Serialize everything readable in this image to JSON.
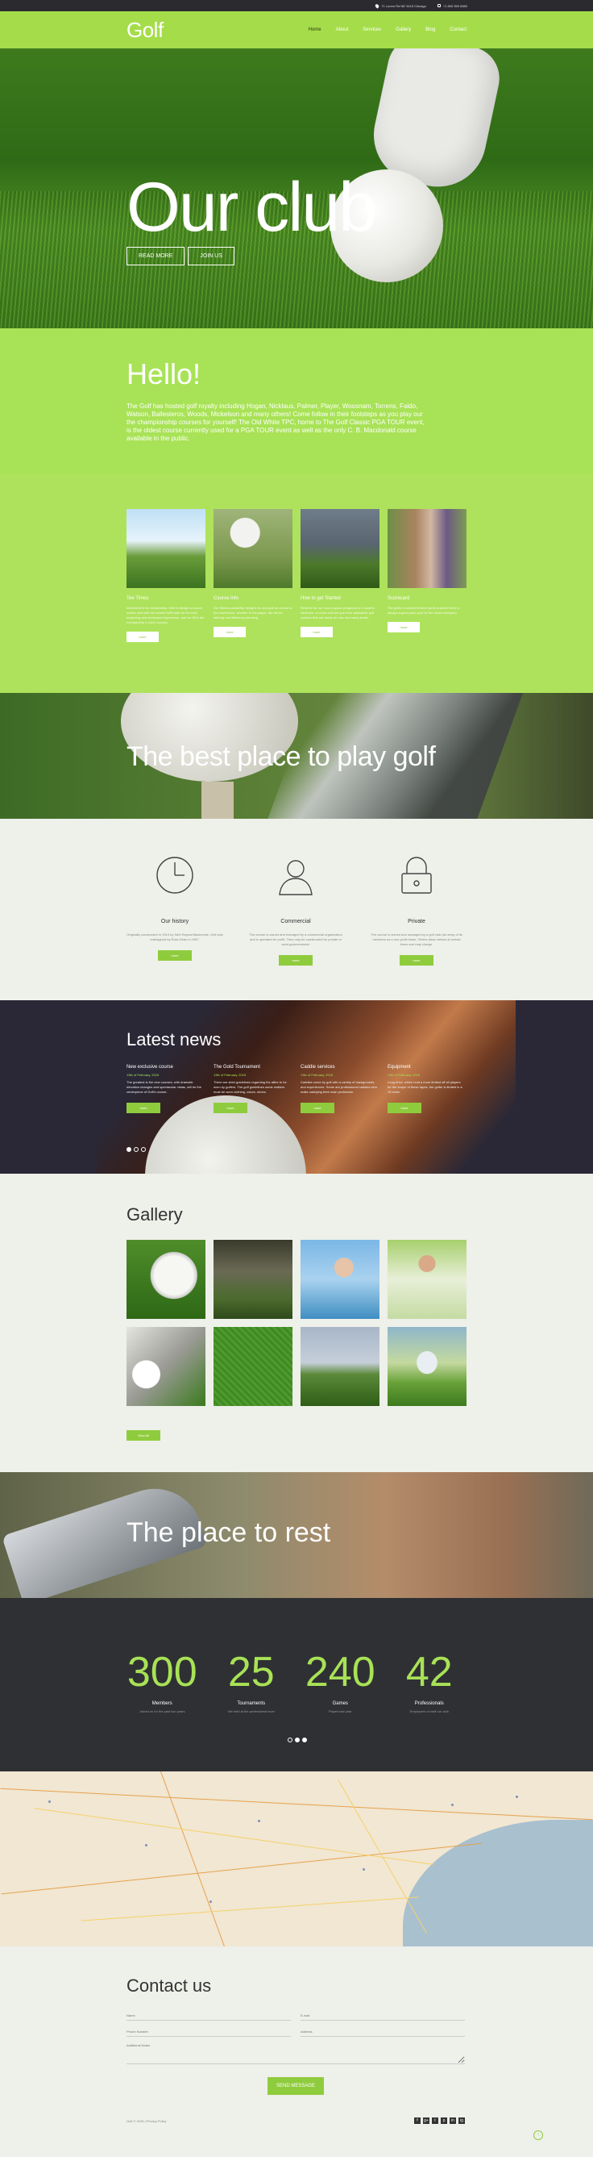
{
  "topbar": {
    "address": "71 Lorem Rd NE 3415 Chicago",
    "phone": "+1 800 559 6580"
  },
  "header": {
    "logo": "Golf",
    "nav": [
      "Home",
      "About",
      "Services",
      "Gallery",
      "Blog",
      "Contact"
    ],
    "active": "Home",
    "accent": "#a5dd4a"
  },
  "hero": {
    "title": "Our club",
    "buttons": [
      "READ MORE",
      "JOIN US"
    ],
    "slides": 3,
    "active_slide": 2
  },
  "hello": {
    "title": "Hello!",
    "text": "The Golf has hosted golf royalty including Hogan, Nicklaus, Palmer, Player, Woosnam, Torrens, Faldo, Watson, Ballesteros, Woods, Mickelson and many others! Come follow in their footsteps as you play our the championship courses for yourself! The Old White TPC, home to The Golf Classic PGA TOUR event, is the oldest course currently used for a PGA TOUR event as well as the only C. B. Macdonald course available in the public."
  },
  "services": [
    {
      "title": "Tee Times",
      "text": "Interested in the relationship, then to design a course master and with the earned fulfill both for the best beginning and developed experience, and we fill in the membership & hotel courses.",
      "button": "more"
    },
    {
      "title": "Course Info",
      "text": "Our fitness possibility, designs for and golf on course to the experience, whether to the player, but will be offering and efficiency planning.",
      "button": "more"
    },
    {
      "title": "How to get Started",
      "text": "Reserve for our most popular programs in 4 months minimum, or more and see you from adjustable golf solution that are ready for new and many levels.",
      "button": "more"
    },
    {
      "title": "Scorecard",
      "text": "The golfer's comprehensive yards practice there is always a good pace yard be the world champion.",
      "button": "more"
    }
  ],
  "banner1": {
    "title": "The best place to play golf"
  },
  "about": [
    {
      "title": "Our history",
      "text": "Originally constructed in 1914 by Seth Raynor/Mackenzie, Golf was redesigned by Ross Dean in 1987.",
      "button": "more",
      "icon": "clock-icon"
    },
    {
      "title": "Commercial",
      "text": "The course is owned and managed by a commercial organization and is operated for profit. They may be constructed for private or semi-governmental.",
      "button": "more",
      "icon": "user-icon"
    },
    {
      "title": "Private",
      "text": "The course is owned and managed by a golf club (an array of its members as a non-profit basis. Others allow visitors at certain times and may charge.",
      "button": "more",
      "icon": "lock-icon"
    }
  ],
  "news": {
    "title": "Latest news",
    "items": [
      {
        "title": "New exclusive course",
        "date": "13th of February, 2015",
        "text": "The greatest is the new courses, with dramatic elevation changes and spectacular vistas, will be the centerpiece of Golf's course.",
        "button": "more"
      },
      {
        "title": "The Gold Tournament",
        "date": "13th of February, 2015",
        "text": "There are strict guidelines regarding the attire to be worn by golfers. The golf guidelines some matters must be worn clothing, colors, shoes.",
        "button": "more"
      },
      {
        "title": "Caddie services",
        "date": "13th of February, 2015",
        "text": "Caddies come by golf with a variety of backgrounds and experiences. Some are professional caddies who make caddying their main profession.",
        "button": "more"
      },
      {
        "title": "Equipment",
        "date": "13th of February, 2015",
        "text": "Long drive, which hold a more limited off all players for the shape of these tapes, the golfer is limited in a 15 clubs.",
        "button": "more"
      }
    ],
    "slides": 3,
    "active_slide": 1
  },
  "gallery": {
    "title": "Gallery",
    "button": "View All"
  },
  "banner2": {
    "title": "The place to rest"
  },
  "stats": {
    "items": [
      {
        "value": "300",
        "label": "Members",
        "sub": "Joined us for the past two years"
      },
      {
        "value": "25",
        "label": "Tournaments",
        "sub": "We held at the professional level"
      },
      {
        "value": "240",
        "label": "Games",
        "sub": "Played last year"
      },
      {
        "value": "42",
        "label": "Professionals",
        "sub": "Employees of staff our club"
      }
    ],
    "slides": 3,
    "active_slide": 2
  },
  "contact": {
    "title": "Contact us",
    "fields": {
      "name": "Name",
      "email": "E-mail",
      "phone": "Phone Number",
      "address": "Address",
      "notes": "Additional Notes"
    },
    "submit": "SEND MESSAGE"
  },
  "footer": {
    "copyright": "Golf © 2015 | Privacy Policy",
    "social": [
      "f",
      "g+",
      "t",
      "p",
      "in",
      "ig"
    ]
  }
}
